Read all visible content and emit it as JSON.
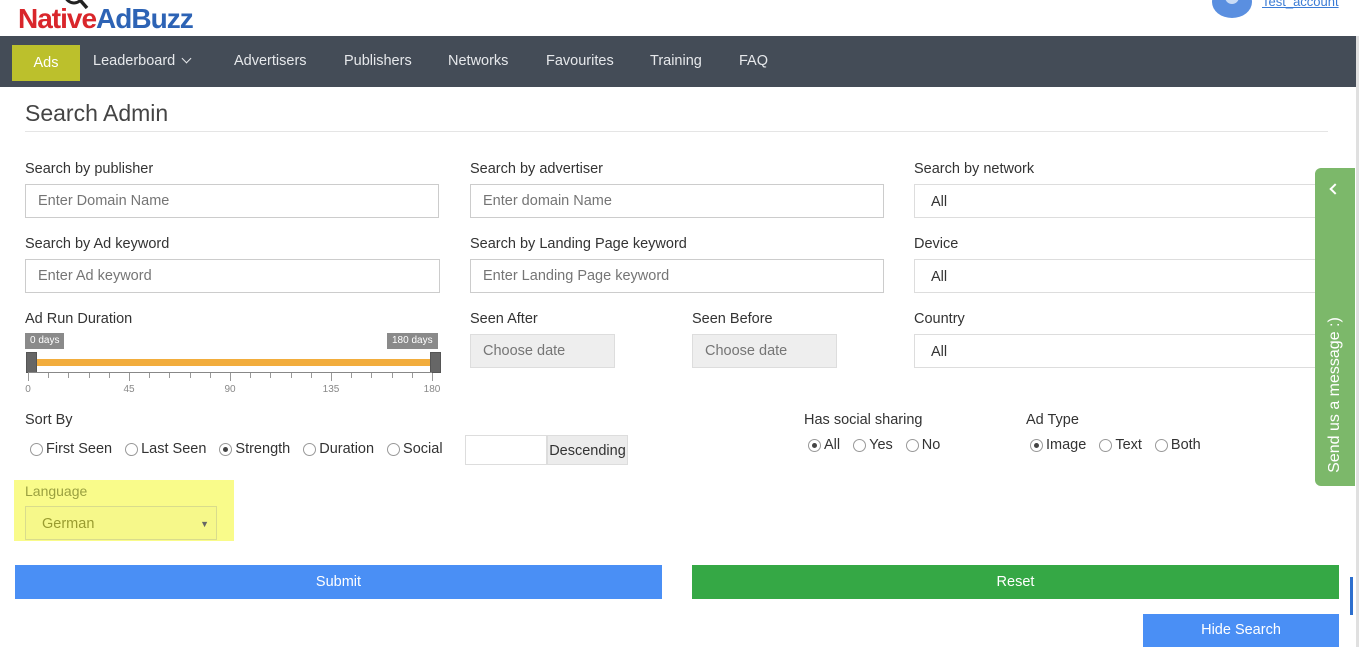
{
  "header": {
    "logo_part1": "Native",
    "logo_part2": "AdBuzz",
    "user_name": "Test_account"
  },
  "nav": {
    "items": [
      {
        "label": "Ads",
        "active": true
      },
      {
        "label": "Leaderboard",
        "has_dropdown": true
      },
      {
        "label": "Advertisers"
      },
      {
        "label": "Publishers"
      },
      {
        "label": "Networks"
      },
      {
        "label": "Favourites"
      },
      {
        "label": "Training"
      },
      {
        "label": "FAQ"
      }
    ]
  },
  "page": {
    "title": "Search Admin"
  },
  "form": {
    "publisher": {
      "label": "Search by publisher",
      "placeholder": "Enter Domain Name"
    },
    "advertiser": {
      "label": "Search by advertiser",
      "placeholder": "Enter domain Name"
    },
    "network": {
      "label": "Search by network",
      "value": "All"
    },
    "ad_keyword": {
      "label": "Search by Ad keyword",
      "placeholder": "Enter Ad keyword"
    },
    "landing_keyword": {
      "label": "Search by Landing Page keyword",
      "placeholder": "Enter Landing Page keyword"
    },
    "device": {
      "label": "Device",
      "value": "All"
    },
    "run_duration": {
      "label": "Ad Run Duration",
      "min_tag": "0 days",
      "max_tag": "180 days",
      "min_value": 0,
      "max_value": 180,
      "tick_labels": [
        "0",
        "45",
        "90",
        "135",
        "180"
      ]
    },
    "seen_after": {
      "label": "Seen After",
      "placeholder": "Choose date"
    },
    "seen_before": {
      "label": "Seen Before",
      "placeholder": "Choose date"
    },
    "country": {
      "label": "Country",
      "value": "All"
    },
    "sort_by": {
      "label": "Sort By",
      "options": [
        "First Seen",
        "Last Seen",
        "Strength",
        "Duration",
        "Social"
      ],
      "selected": "Strength",
      "order_label": "Descending"
    },
    "social_sharing": {
      "label": "Has social sharing",
      "options": [
        "All",
        "Yes",
        "No"
      ],
      "selected": "All"
    },
    "ad_type": {
      "label": "Ad Type",
      "options": [
        "Image",
        "Text",
        "Both"
      ],
      "selected": "Image"
    },
    "language": {
      "label": "Language",
      "value": "German"
    }
  },
  "buttons": {
    "submit": "Submit",
    "reset": "Reset",
    "hide_search": "Hide Search"
  },
  "feedback_tab": {
    "label": "Send us a message :)"
  },
  "colors": {
    "nav_bg": "#444c57",
    "nav_active": "#bcc02c",
    "submit": "#4a8ff5",
    "reset": "#35a845",
    "slider": "#f2ad3d",
    "highlight": "#f9fb8a",
    "feedback": "#7cb86a"
  }
}
